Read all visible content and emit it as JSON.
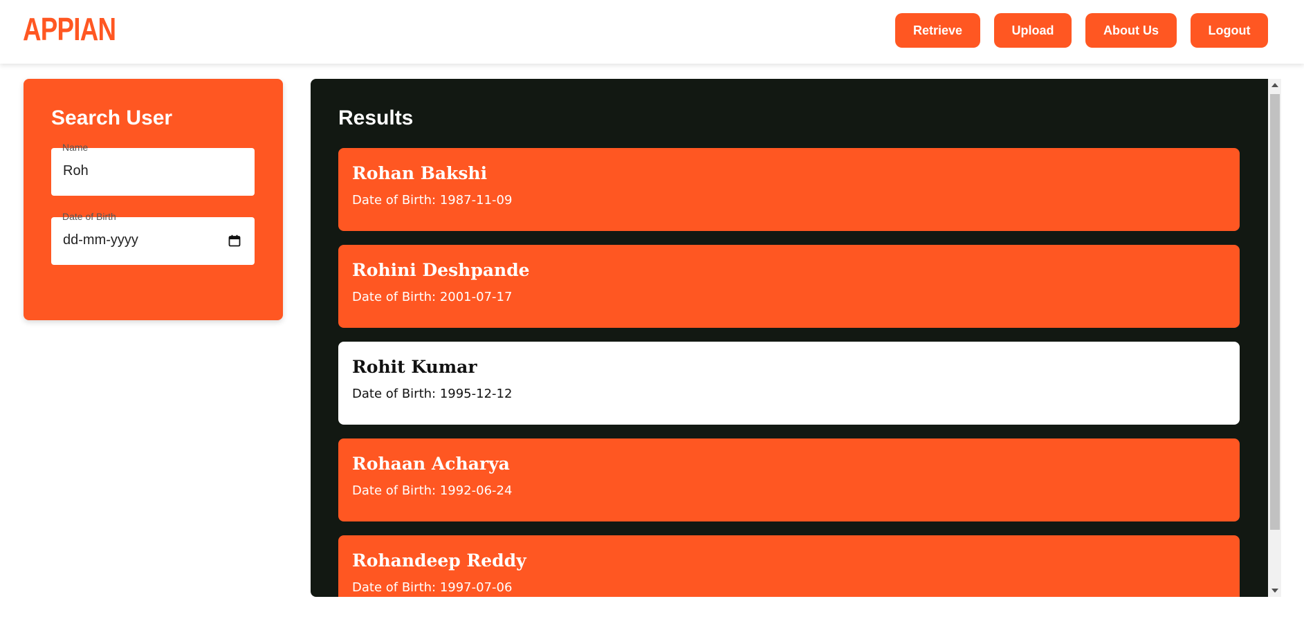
{
  "header": {
    "logo": "APPIAN",
    "nav": {
      "retrieve": "Retrieve",
      "upload": "Upload",
      "about": "About Us",
      "logout": "Logout"
    }
  },
  "search": {
    "title": "Search User",
    "name_label": "Name",
    "name_value": "Roh",
    "dob_label": "Date of Birth",
    "dob_value": "dd-mm-yyyy"
  },
  "results": {
    "title": "Results",
    "items": [
      {
        "name": "Rohan Bakshi",
        "dob": "Date of Birth: 1987-11-09",
        "selected": false
      },
      {
        "name": "Rohini Deshpande",
        "dob": "Date of Birth: 2001-07-17",
        "selected": false
      },
      {
        "name": "Rohit Kumar",
        "dob": "Date of Birth: 1995-12-12",
        "selected": true
      },
      {
        "name": "Rohaan Acharya",
        "dob": "Date of Birth: 1992-06-24",
        "selected": false
      },
      {
        "name": "Rohandeep Reddy",
        "dob": "Date of Birth: 1997-07-06",
        "selected": false
      }
    ]
  },
  "colors": {
    "accent": "#ff5722",
    "results_bg": "#121812",
    "selected_card": "#ffffff"
  },
  "icons": {
    "calendar": "calendar-icon"
  }
}
